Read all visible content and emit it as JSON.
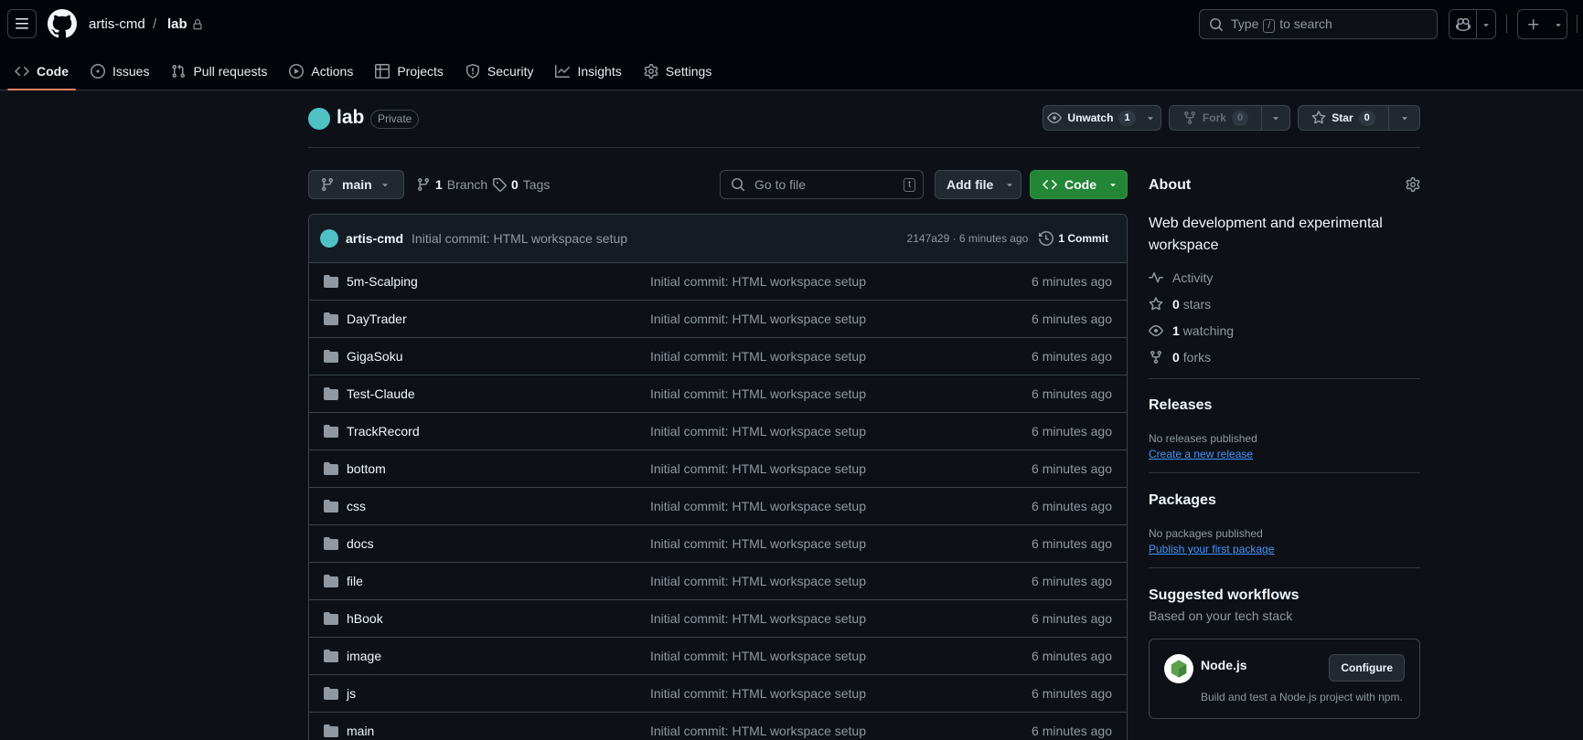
{
  "header": {
    "owner": "artis-cmd",
    "separator": "/",
    "repo": "lab",
    "search_prefix": "Type",
    "search_key": "/",
    "search_suffix": "to search"
  },
  "nav": {
    "tabs": [
      {
        "label": "Code",
        "icon": "code-icon",
        "active": true
      },
      {
        "label": "Issues",
        "icon": "issue-opened-icon"
      },
      {
        "label": "Pull requests",
        "icon": "git-pull-request-icon"
      },
      {
        "label": "Actions",
        "icon": "play-icon"
      },
      {
        "label": "Projects",
        "icon": "table-icon"
      },
      {
        "label": "Security",
        "icon": "shield-icon"
      },
      {
        "label": "Insights",
        "icon": "graph-icon"
      },
      {
        "label": "Settings",
        "icon": "gear-icon"
      }
    ]
  },
  "repo": {
    "name": "lab",
    "visibility": "Private",
    "unwatch_label": "Unwatch",
    "watch_count": "1",
    "fork_label": "Fork",
    "fork_count": "0",
    "star_label": "Star",
    "star_count": "0"
  },
  "files_nav": {
    "branch": "main",
    "branch_count": "1",
    "branch_label": "Branch",
    "tag_count": "0",
    "tag_label": "Tags",
    "goto_placeholder": "Go to file",
    "goto_key": "t",
    "add_file": "Add file",
    "code": "Code"
  },
  "commit": {
    "author": "artis-cmd",
    "message": "Initial commit: HTML workspace setup",
    "hash_time": "2147a29 · 6 minutes ago",
    "count_label": "1 Commit"
  },
  "files": [
    {
      "name": "5m-Scalping",
      "message": "Initial commit: HTML workspace setup",
      "age": "6 minutes ago"
    },
    {
      "name": "DayTrader",
      "message": "Initial commit: HTML workspace setup",
      "age": "6 minutes ago"
    },
    {
      "name": "GigaSoku",
      "message": "Initial commit: HTML workspace setup",
      "age": "6 minutes ago"
    },
    {
      "name": "Test-Claude",
      "message": "Initial commit: HTML workspace setup",
      "age": "6 minutes ago"
    },
    {
      "name": "TrackRecord",
      "message": "Initial commit: HTML workspace setup",
      "age": "6 minutes ago"
    },
    {
      "name": "bottom",
      "message": "Initial commit: HTML workspace setup",
      "age": "6 minutes ago"
    },
    {
      "name": "css",
      "message": "Initial commit: HTML workspace setup",
      "age": "6 minutes ago"
    },
    {
      "name": "docs",
      "message": "Initial commit: HTML workspace setup",
      "age": "6 minutes ago"
    },
    {
      "name": "file",
      "message": "Initial commit: HTML workspace setup",
      "age": "6 minutes ago"
    },
    {
      "name": "hBook",
      "message": "Initial commit: HTML workspace setup",
      "age": "6 minutes ago"
    },
    {
      "name": "image",
      "message": "Initial commit: HTML workspace setup",
      "age": "6 minutes ago"
    },
    {
      "name": "js",
      "message": "Initial commit: HTML workspace setup",
      "age": "6 minutes ago"
    },
    {
      "name": "main",
      "message": "Initial commit: HTML workspace setup",
      "age": "6 minutes ago"
    }
  ],
  "about": {
    "title": "About",
    "description": "Web development and experimental workspace",
    "activity": "Activity",
    "stars_count": "0",
    "stars_label": "stars",
    "watching_count": "1",
    "watching_label": "watching",
    "forks_count": "0",
    "forks_label": "forks"
  },
  "releases": {
    "title": "Releases",
    "empty": "No releases published",
    "create_link": "Create a new release"
  },
  "packages": {
    "title": "Packages",
    "empty": "No packages published",
    "publish_link": "Publish your first package"
  },
  "workflows": {
    "title": "Suggested workflows",
    "subtitle": "Based on your tech stack",
    "card_name": "Node.js",
    "card_desc": "Build and test a Node.js project with npm.",
    "configure": "Configure"
  },
  "colors": {
    "background": "#0d1117",
    "header": "#010409",
    "accent_green": "#238636",
    "active_tab": "#f78166",
    "link": "#4493f8"
  }
}
